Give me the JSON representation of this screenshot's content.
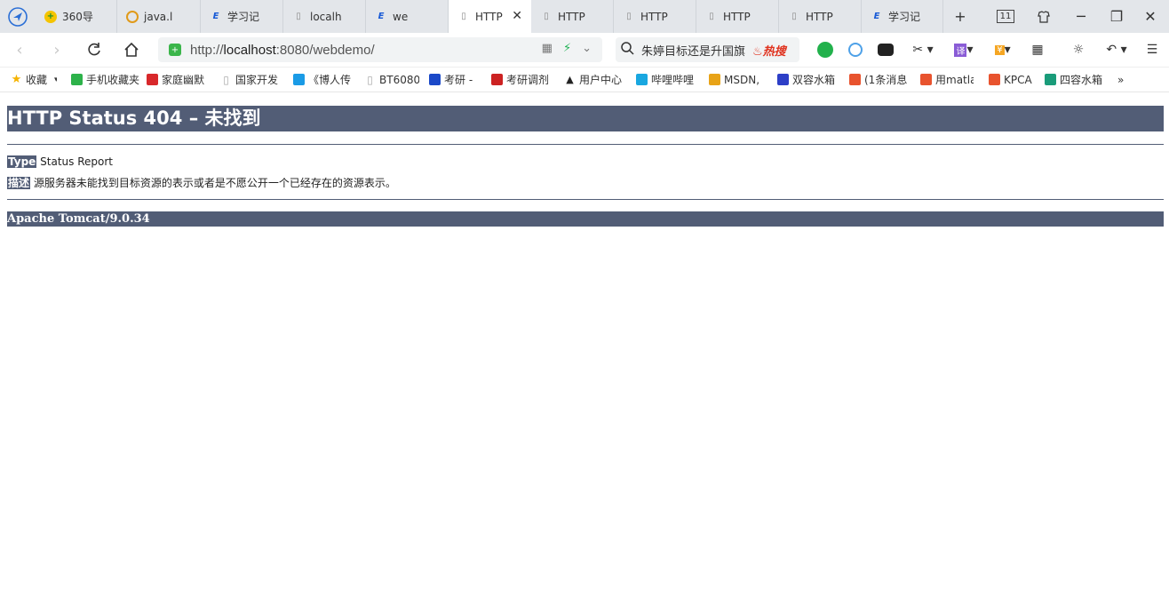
{
  "tabs": [
    {
      "label": "360导",
      "icon": "360-icon"
    },
    {
      "label": "java.l",
      "icon": "circle-icon"
    },
    {
      "label": "学习记",
      "icon": "e-blog-icon"
    },
    {
      "label": "localh",
      "icon": "page-icon"
    },
    {
      "label": "we",
      "icon": "e-blog-icon"
    },
    {
      "label": "HTTP",
      "icon": "page-icon",
      "active": true
    },
    {
      "label": "HTTP",
      "icon": "page-icon"
    },
    {
      "label": "HTTP",
      "icon": "page-icon"
    },
    {
      "label": "HTTP",
      "icon": "page-icon"
    },
    {
      "label": "HTTP",
      "icon": "page-icon"
    },
    {
      "label": "学习记",
      "icon": "e-blog-icon"
    }
  ],
  "tab_count": "11",
  "address": {
    "prefix": "http://",
    "host": "localhost",
    "rest": ":8080/webdemo/"
  },
  "search": {
    "text": "朱婷目标还是升国旗",
    "hot": "热搜"
  },
  "bookmarks": [
    {
      "label": "收藏",
      "icon": "star-icon",
      "color": "#f5b300"
    },
    {
      "label": "手机收藏夹",
      "icon": "phone-icon",
      "color": "#2db24a"
    },
    {
      "label": "家庭幽默",
      "icon": "play-icon",
      "color": "#d8282b"
    },
    {
      "label": "国家开发",
      "icon": "page-icon",
      "color": "#aaaaaa"
    },
    {
      "label": "《博人传",
      "icon": "youku-icon",
      "color": "#1a9be6"
    },
    {
      "label": "BT6080",
      "icon": "page-icon",
      "color": "#aaaaaa"
    },
    {
      "label": "考研 -",
      "icon": "grid-icon",
      "color": "#1b49c8"
    },
    {
      "label": "考研调剂",
      "icon": "kaoyan-icon",
      "color": "#cc2222"
    },
    {
      "label": "用户中心",
      "icon": "cap-icon",
      "color": "#222222"
    },
    {
      "label": "哔哩哔哩",
      "icon": "bilibili-icon",
      "color": "#19a7e0"
    },
    {
      "label": "MSDN,",
      "icon": "msdn-icon",
      "color": "#e8a317"
    },
    {
      "label": "双容水箱",
      "icon": "paw-icon",
      "color": "#2d3fc7"
    },
    {
      "label": "(1条消息",
      "icon": "csdn-icon",
      "color": "#e8532e"
    },
    {
      "label": "用matla",
      "icon": "csdn-icon",
      "color": "#e8532e"
    },
    {
      "label": "KPCA",
      "icon": "csdn-icon",
      "color": "#e8532e"
    },
    {
      "label": "四容水箱",
      "icon": "doc-icon",
      "color": "#1a9c7a"
    }
  ],
  "more_label": "»",
  "page": {
    "title": "HTTP Status 404 – 未找到",
    "type_label": "Type",
    "type_value": "Status Report",
    "desc_label": "描述",
    "desc_value": "源服务器未能找到目标资源的表示或者是不愿公开一个已经存在的资源表示。",
    "footer": "Apache Tomcat/9.0.34"
  },
  "colors": {
    "header_bg": "#525d76",
    "tabstrip_bg": "#e3e6ea"
  }
}
